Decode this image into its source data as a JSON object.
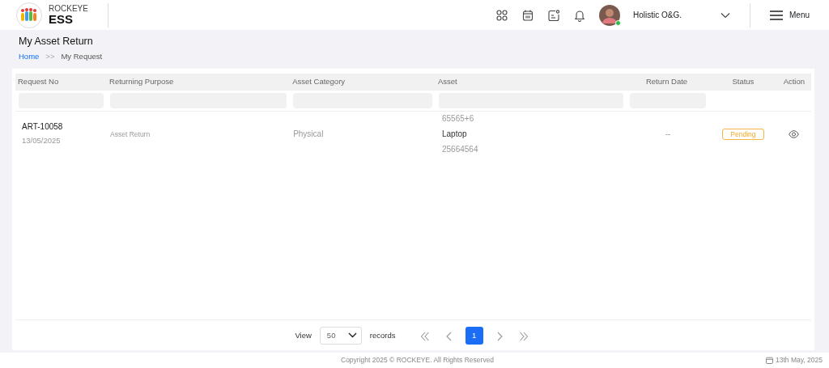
{
  "header": {
    "brand_top": "ROCKEYE",
    "brand": "ESS",
    "user_name": "Holistic O&G.",
    "user_online": true,
    "menu_label": "Menu"
  },
  "page": {
    "title": "My Asset Return",
    "breadcrumb": [
      {
        "label": "Home",
        "kind": "link"
      },
      {
        "label": ">>",
        "kind": "separator"
      },
      {
        "label": "My Request",
        "kind": "current"
      }
    ]
  },
  "table": {
    "columns": [
      {
        "label": "Request No",
        "filterable": true
      },
      {
        "label": "Returning Purpose",
        "filterable": true
      },
      {
        "label": "Asset Category",
        "filterable": true
      },
      {
        "label": "Asset",
        "filterable": true
      },
      {
        "label": "Return Date",
        "filterable": true
      },
      {
        "label": "Status",
        "filterable": false
      },
      {
        "label": "Action",
        "filterable": false
      }
    ],
    "rows": [
      {
        "request_no": "ART-10058",
        "request_date": "13/05/2025",
        "purpose": "Asset Return",
        "category": "Physical",
        "asset_code": "65565+6",
        "asset_name": "Laptop",
        "asset_serial": "25664564",
        "return_date": "--",
        "status": "Pending"
      }
    ]
  },
  "pagination": {
    "view_label": "View",
    "page_size": "50",
    "records_label": "records",
    "pages": [
      {
        "label": "1",
        "selected": true
      }
    ]
  },
  "footer": {
    "copyright": "Copyright 2025 © ROCKEYE. All Rights Reserved",
    "date": "13th May, 2025"
  }
}
